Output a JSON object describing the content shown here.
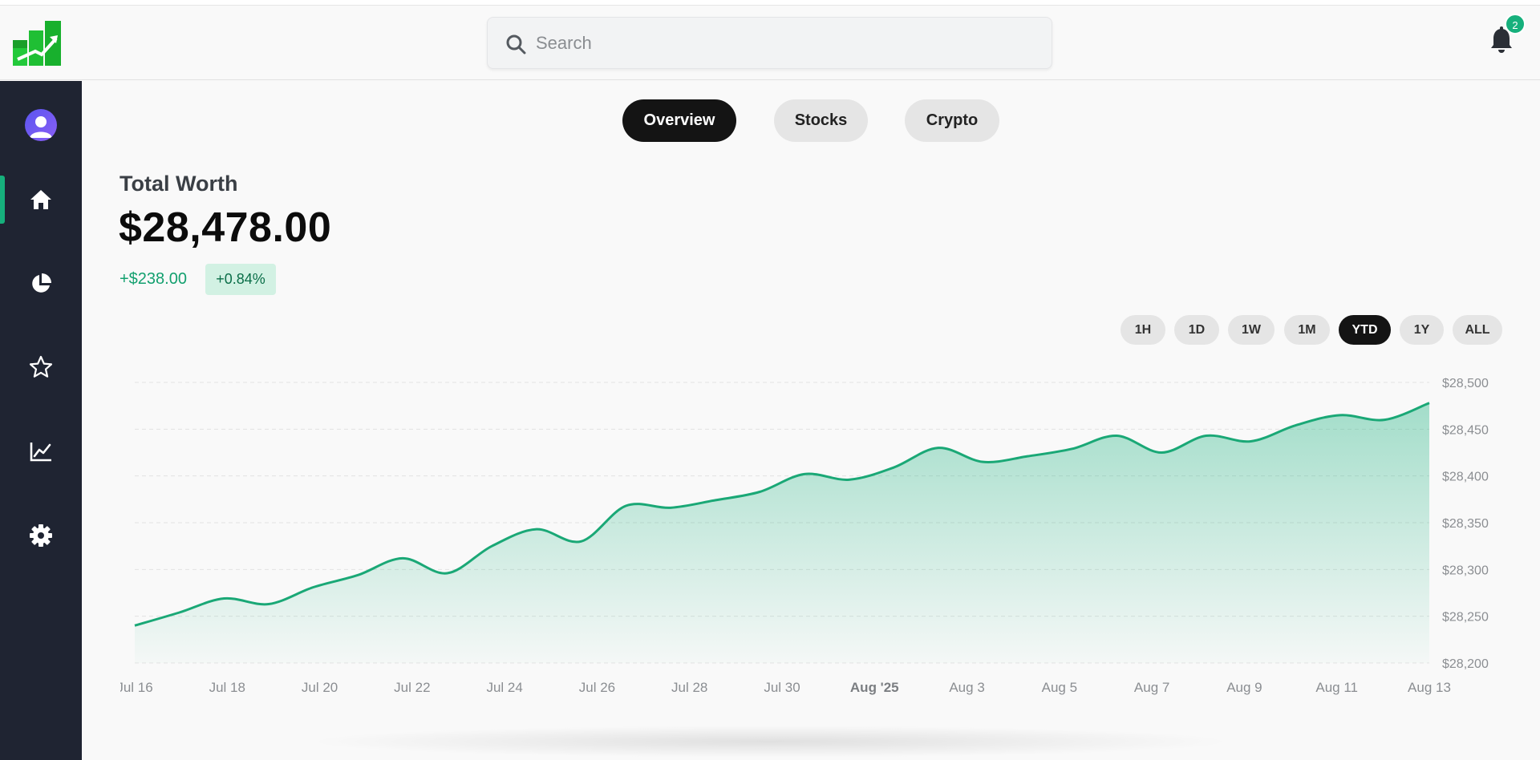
{
  "header": {
    "search_placeholder": "Search",
    "notification_count": "2"
  },
  "sidebar": {
    "items": [
      {
        "name": "home",
        "icon": "home-icon",
        "active": true
      },
      {
        "name": "portfolio",
        "icon": "pie-chart-icon",
        "active": false
      },
      {
        "name": "watchlist",
        "icon": "star-icon",
        "active": false
      },
      {
        "name": "analytics",
        "icon": "line-chart-icon",
        "active": false
      },
      {
        "name": "settings",
        "icon": "gear-icon",
        "active": false
      }
    ]
  },
  "tabs": [
    {
      "label": "Overview",
      "active": true
    },
    {
      "label": "Stocks",
      "active": false
    },
    {
      "label": "Crypto",
      "active": false
    }
  ],
  "summary": {
    "label": "Total Worth",
    "value": "$28,478.00",
    "change": "+$238.00",
    "change_pct": "+0.84%"
  },
  "ranges": [
    {
      "label": "1H",
      "active": false
    },
    {
      "label": "1D",
      "active": false
    },
    {
      "label": "1W",
      "active": false
    },
    {
      "label": "1M",
      "active": false
    },
    {
      "label": "YTD",
      "active": true
    },
    {
      "label": "1Y",
      "active": false
    },
    {
      "label": "ALL",
      "active": false
    }
  ],
  "colors": {
    "accent": "#16b07c",
    "line": "#1aa876",
    "sidebar_bg": "#1f2432"
  },
  "chart_data": {
    "type": "area",
    "title": "",
    "xlabel": "",
    "ylabel": "",
    "ylim": [
      28200,
      28500
    ],
    "y_ticks": [
      "$28,500",
      "$28,450",
      "$28,400",
      "$28,350",
      "$28,300",
      "$28,250",
      "$28,200"
    ],
    "y_tick_values": [
      28500,
      28450,
      28400,
      28350,
      28300,
      28250,
      28200
    ],
    "x_ticks": [
      "Jul 16",
      "Jul 18",
      "Jul 20",
      "Jul 22",
      "Jul 24",
      "Jul 26",
      "Jul 28",
      "Jul 30",
      "Aug '25",
      "Aug 3",
      "Aug 5",
      "Aug 7",
      "Aug 9",
      "Aug 11",
      "Aug 13"
    ],
    "x_tick_bold": [
      false,
      false,
      false,
      false,
      false,
      false,
      false,
      false,
      true,
      false,
      false,
      false,
      false,
      false,
      false
    ],
    "x": [
      "Jul 16",
      "Jul 17",
      "Jul 18",
      "Jul 19",
      "Jul 20",
      "Jul 21",
      "Jul 22",
      "Jul 23",
      "Jul 24",
      "Jul 25",
      "Jul 26",
      "Jul 27",
      "Jul 28",
      "Jul 29",
      "Jul 30",
      "Jul 31",
      "Aug 1",
      "Aug 2",
      "Aug 3",
      "Aug 4",
      "Aug 5",
      "Aug 6",
      "Aug 7",
      "Aug 8",
      "Aug 9",
      "Aug 10",
      "Aug 11",
      "Aug 12",
      "Aug 13"
    ],
    "series": [
      {
        "values": [
          28240,
          28254,
          28269,
          28263,
          28281,
          28294,
          28312,
          28296,
          28325,
          28343,
          28330,
          28368,
          28366,
          28374,
          28383,
          28402,
          28396,
          28409,
          28430,
          28415,
          28421,
          28429,
          28443,
          28425,
          28443,
          28437,
          28454,
          28465,
          28460
        ]
      }
    ],
    "end_value": 28478,
    "grid": true,
    "legend": "none"
  }
}
